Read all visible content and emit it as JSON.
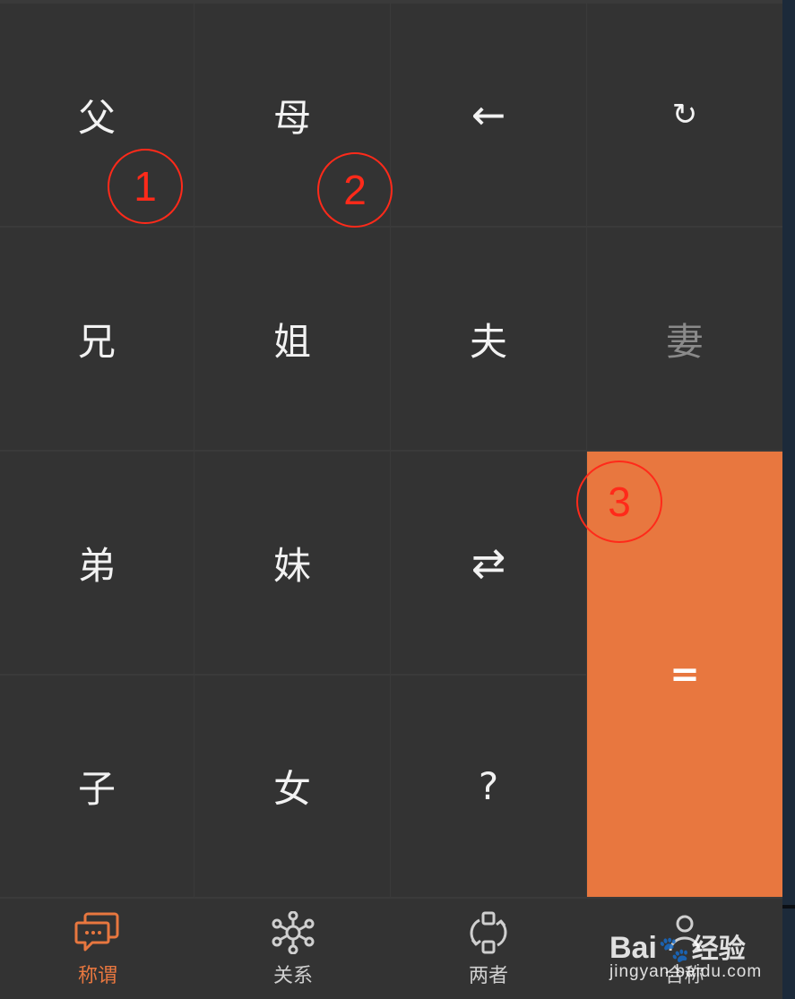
{
  "keypad": {
    "father": "父",
    "mother": "母",
    "backspace": "←",
    "reset": "↻",
    "elder_brother": "兄",
    "elder_sister": "姐",
    "husband": "夫",
    "wife": "妻",
    "younger_brother": "弟",
    "younger_sister": "妹",
    "swap": "⇄",
    "son": "子",
    "daughter": "女",
    "unknown": "?",
    "equals": "="
  },
  "nav": {
    "items": [
      {
        "label": "称谓",
        "icon": "chat-bubbles-icon",
        "active": true
      },
      {
        "label": "关系",
        "icon": "network-icon",
        "active": false
      },
      {
        "label": "两者",
        "icon": "two-way-cycle-icon",
        "active": false
      },
      {
        "label": "合称",
        "icon": "group-icon",
        "active": false
      }
    ]
  },
  "annotations": [
    "1",
    "2",
    "3"
  ],
  "watermark": {
    "brand_latin": "Bai",
    "brand_cn": "经验",
    "url": "jingyan.baidu.com"
  },
  "colors": {
    "accent": "#e8773f",
    "key_bg": "#333333",
    "annotation": "#ff2a1a"
  }
}
